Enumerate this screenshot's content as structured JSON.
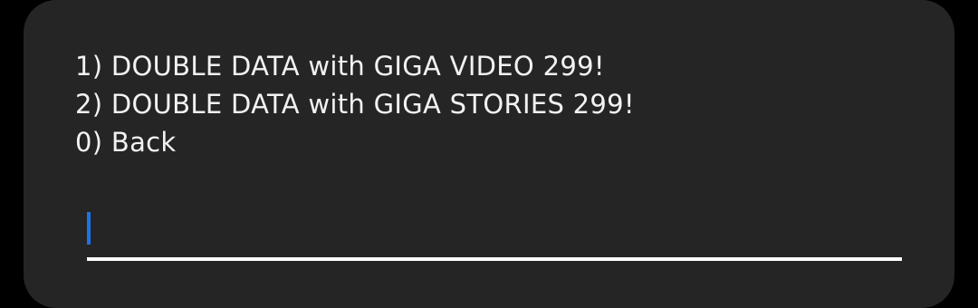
{
  "ussd_dialog": {
    "menu_items": [
      "1) DOUBLE DATA with GIGA VIDEO 299!",
      "2) DOUBLE DATA with GIGA STORIES 299!",
      "0) Back"
    ],
    "reply_input": {
      "value": "",
      "placeholder": ""
    },
    "colors": {
      "background": "#252525",
      "text": "#f2f2f2",
      "cursor": "#1a73e8",
      "underline": "#ffffff"
    }
  }
}
